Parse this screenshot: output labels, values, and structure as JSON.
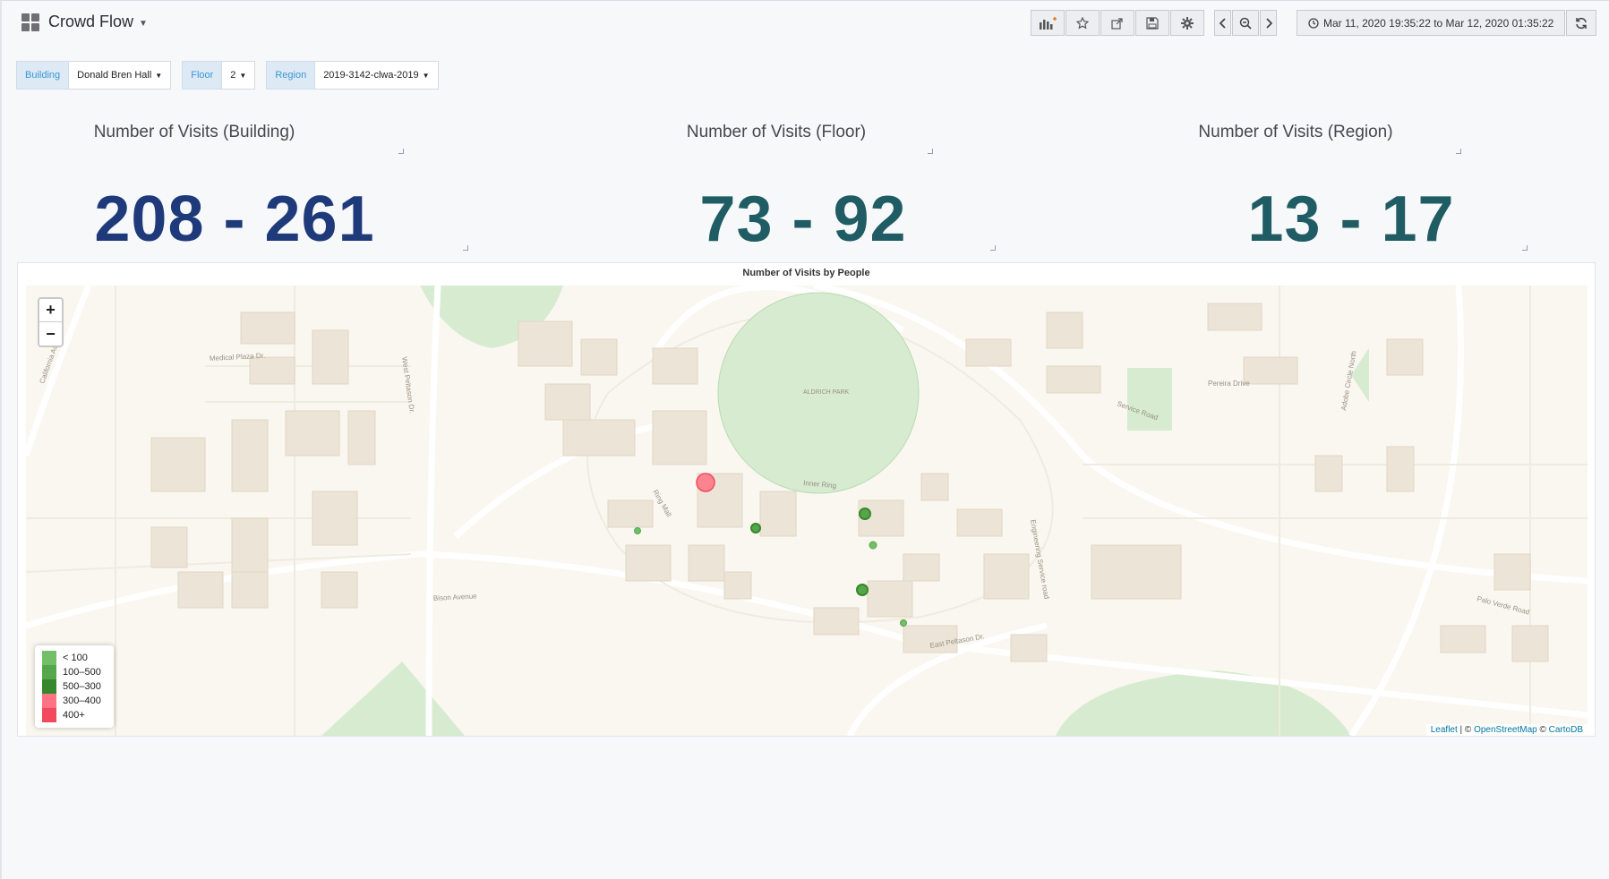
{
  "header": {
    "title": "Crowd Flow",
    "time_range": "Mar 11, 2020 19:35:22 to Mar 12, 2020 01:35:22"
  },
  "variables": [
    {
      "label": "Building",
      "value": "Donald Bren Hall"
    },
    {
      "label": "Floor",
      "value": "2"
    },
    {
      "label": "Region",
      "value": "2019-3142-clwa-2019"
    }
  ],
  "stats": [
    {
      "title": "Number of Visits (Building)",
      "value": "208 - 261",
      "color": "#1f3a7a"
    },
    {
      "title": "Number of Visits (Floor)",
      "value": "73 - 92",
      "color": "#1f5c63"
    },
    {
      "title": "Number of Visits (Region)",
      "value": "13 - 17",
      "color": "#1f5c63"
    }
  ],
  "map": {
    "title": "Number of Visits by People",
    "zoom_in": "+",
    "zoom_out": "−",
    "labels": {
      "park": "ALDRICH PARK",
      "inner_ring": "Inner Ring",
      "ring_mall": "Ring Mall",
      "west_peltason": "West Peltason Dr.",
      "east_peltason": "East Peltason Dr.",
      "bison": "Bison Avenue",
      "medical_plaza": "Medical Plaza Dr.",
      "california": "California Ave",
      "pereira": "Pereira Drive",
      "service_road": "Service Road",
      "engineering": "Engineering Service road",
      "adobe": "Adobe Circle North",
      "palo_verde": "Palo Verde Road"
    },
    "legend": [
      {
        "label": "< 100",
        "color": "#73bf69"
      },
      {
        "label": "100–500",
        "color": "#56a64b"
      },
      {
        "label": "500–300",
        "color": "#37872d"
      },
      {
        "label": "300–400",
        "color": "#ff7383"
      },
      {
        "label": "400+",
        "color": "#f2495c"
      }
    ],
    "attribution": {
      "leaflet": "Leaflet",
      "sep": " | © ",
      "osm": "OpenStreetMap",
      "sep2": " © ",
      "carto": "CartoDB"
    }
  }
}
